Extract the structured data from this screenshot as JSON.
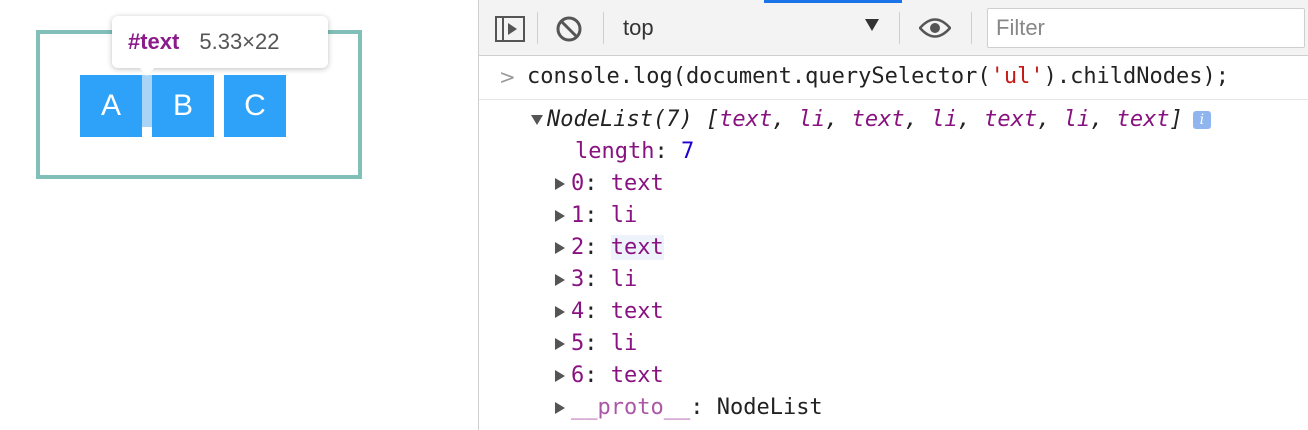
{
  "preview": {
    "items": [
      "A",
      "B",
      "C"
    ],
    "tooltip": {
      "tag": "#text",
      "size": "5.33×22"
    }
  },
  "toolbar": {
    "context": "top",
    "filter_placeholder": "Filter",
    "icons": [
      "sidebar-toggle-icon",
      "clear-console-icon",
      "eye-icon"
    ]
  },
  "console": {
    "prompt": ">",
    "command_prefix": "console.log(document.querySelector(",
    "command_string": "'ul'",
    "command_suffix": ").childNodes);",
    "nodelist": {
      "summary_head": "NodeList(7) [",
      "summary_items": [
        "text",
        "li",
        "text",
        "li",
        "text",
        "li",
        "text"
      ],
      "summary_tail": "]",
      "length_key": "length",
      "length_value": "7",
      "entries": [
        {
          "index": "0",
          "value": "text"
        },
        {
          "index": "1",
          "value": "li"
        },
        {
          "index": "2",
          "value": "text"
        },
        {
          "index": "3",
          "value": "li"
        },
        {
          "index": "4",
          "value": "text"
        },
        {
          "index": "5",
          "value": "li"
        },
        {
          "index": "6",
          "value": "text"
        }
      ],
      "proto_key": "__proto__",
      "proto_value": "NodeList"
    }
  },
  "colors": {
    "li_fill": "#2ea1f8",
    "ul_border": "#80c0b8",
    "key_purple": "#881280",
    "number_blue": "#1c00cf"
  }
}
